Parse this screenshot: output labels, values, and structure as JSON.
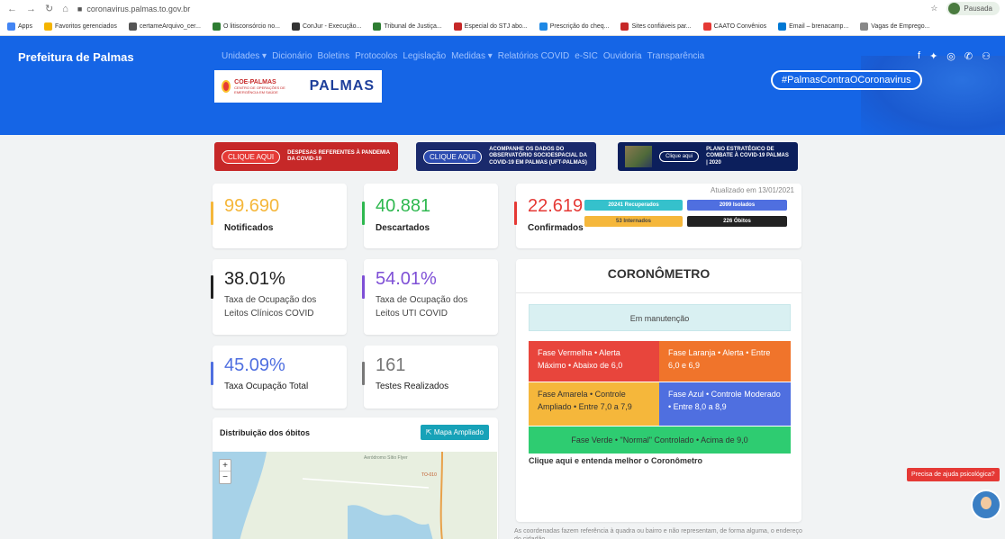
{
  "browser": {
    "url": "coronavirus.palmas.to.gov.br",
    "profile": "Pausada",
    "bookmarks": [
      {
        "label": "Apps",
        "color": "#4285f4"
      },
      {
        "label": "Favoritos gerenciados",
        "color": "#f4b400"
      },
      {
        "label": "certameArquivo_cer...",
        "color": "#555555"
      },
      {
        "label": "O litisconsórcio no...",
        "color": "#2e7d32"
      },
      {
        "label": "ConJur - Execução...",
        "color": "#333333"
      },
      {
        "label": "Tribunal de Justiça...",
        "color": "#2e7d32"
      },
      {
        "label": "Especial do STJ abo...",
        "color": "#c62828"
      },
      {
        "label": "Prescrição do cheq...",
        "color": "#1e88e5"
      },
      {
        "label": "Sites confiáveis par...",
        "color": "#c62828"
      },
      {
        "label": "CAATO Convênios",
        "color": "#e53935"
      },
      {
        "label": "Email – brenacamp...",
        "color": "#0078d4"
      },
      {
        "label": "Vagas de Emprego...",
        "color": "#888888"
      }
    ]
  },
  "site": {
    "brand": "Prefeitura de Palmas",
    "menu": [
      "Unidades ▾",
      "Dicionário",
      "Boletins",
      "Protocolos",
      "Legislação",
      "Medidas ▾",
      "Relatórios COVID",
      "e-SIC",
      "Ouvidoria",
      "Transparência"
    ],
    "hashtag": "#PalmasContraOCoronavirus",
    "logo_coe": "COE-PALMAS",
    "logo_coe_sub": "CENTRO DE OPERAÇÕES DE EMERGÊNCIA EM SAÚDE",
    "logo_palmas": "PALMAS"
  },
  "banners": [
    {
      "cta": "CLIQUE AQUI",
      "text": "DESPESAS REFERENTES À PANDEMIA DA COVID-19"
    },
    {
      "cta": "CLIQUE AQUI",
      "text": "ACOMPANHE OS DADOS DO OBSERVATÓRIO SOCIOESPACIAL DA COVID-19 EM PALMAS (UFT-PALMAS)"
    },
    {
      "cta": "Clique aqui",
      "text": "PLANO ESTRATÉGICO DE COMBATE À COVID-19 PALMAS | 2020"
    }
  ],
  "stats": {
    "notificados": {
      "value": "99.690",
      "label": "Notificados",
      "color": "#f5b73b"
    },
    "descartados": {
      "value": "40.881",
      "label": "Descartados",
      "color": "#2eb84f"
    },
    "confirmados": {
      "value": "22.619",
      "label": "Confirmados",
      "color": "#e53935",
      "updated": "Atualizado em 13/01/2021"
    },
    "chips": [
      {
        "text": "20241 Recuperados",
        "color": "#35c1cc"
      },
      {
        "text": "2099 Isolados",
        "color": "#4f6fe0"
      },
      {
        "text": "53 Internados",
        "color": "#f5b73b"
      },
      {
        "text": "226 Óbitos",
        "color": "#222222"
      }
    ],
    "clinicos": {
      "value": "38.01%",
      "label": "Taxa de Ocupação dos Leitos Clínicos COVID",
      "color": "#222222"
    },
    "uti": {
      "value": "54.01%",
      "label": "Taxa de Ocupação dos Leitos UTI COVID",
      "color": "#7e4fd6"
    },
    "total": {
      "value": "45.09%",
      "label": "Taxa Ocupação Total",
      "color": "#4f6fe0"
    },
    "testes": {
      "value": "161",
      "label": "Testes Realizados",
      "color": "#777777"
    }
  },
  "coronometro": {
    "title": "CORONÔMETRO",
    "status": "Em manutenção",
    "phases": [
      {
        "text": "Fase Vermelha • Alerta Máximo • Abaixo de 6,0",
        "color": "#e8453c"
      },
      {
        "text": "Fase Laranja • Alerta • Entre 6,0 e 6,9",
        "color": "#f0742b"
      },
      {
        "text": "Fase Amarela • Controle Ampliado • Entre 7,0 a 7,9",
        "color": "#f5b73b"
      },
      {
        "text": "Fase Azul • Controle Moderado • Entre 8,0 a 8,9",
        "color": "#4f6fe0"
      },
      {
        "text": "Fase Verde • \"Normal\" Controlado • Acima de 9,0",
        "color": "#2ecc71"
      }
    ],
    "link": "Clique aqui e entenda melhor o Coronômetro"
  },
  "map": {
    "title": "Distribuição dos óbitos",
    "button": "Mapa Ampliado",
    "zoom_in": "+",
    "zoom_out": "−",
    "place": "Aeródromo Sítio Flyer",
    "road": "TO-010"
  },
  "footnote": "As coordenadas fazem referência à quadra ou bairro e não representam, de forma alguma, o endereço do cidadão.",
  "help": "Precisa de ajuda psicológica?"
}
